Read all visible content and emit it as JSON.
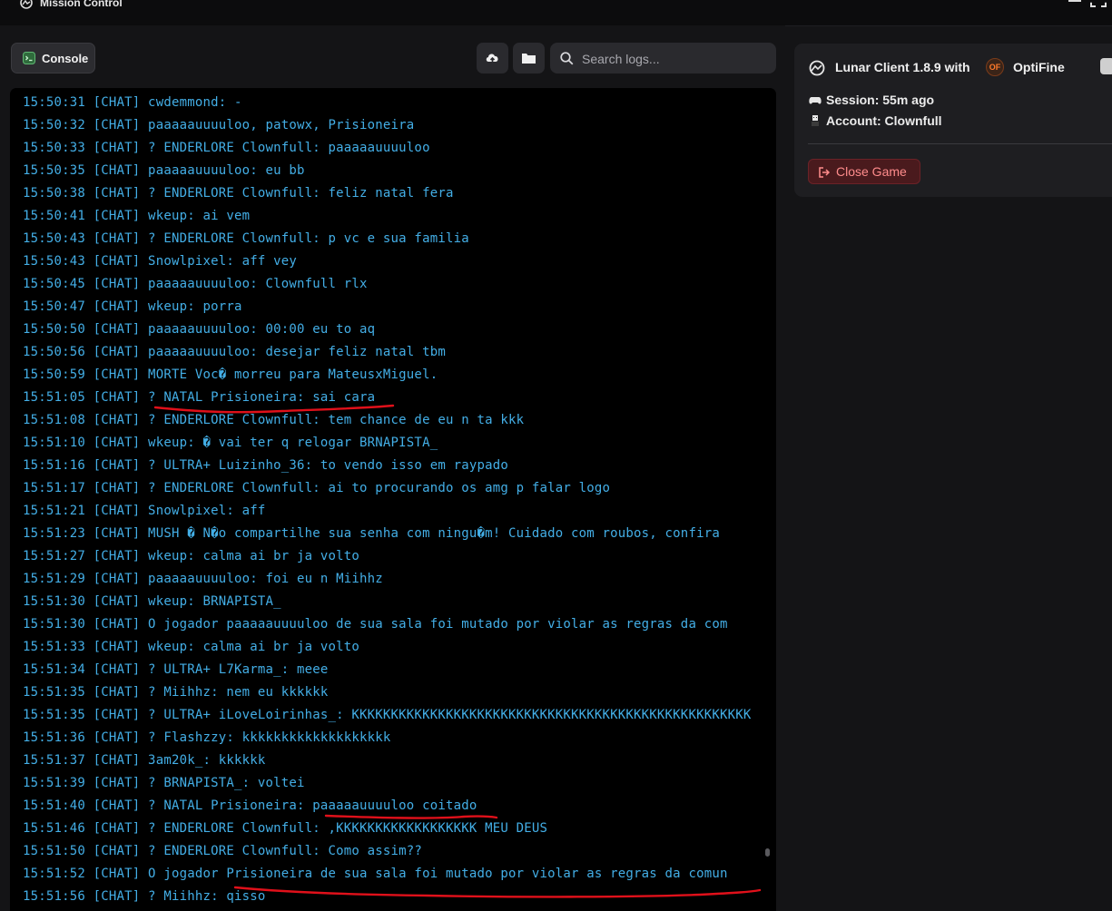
{
  "window": {
    "title": "Mission Control"
  },
  "toolbar": {
    "console_label": "Console",
    "search_placeholder": "Search logs..."
  },
  "log_lines": [
    "15:50:31 [CHAT] cwdemmond: -",
    "15:50:32 [CHAT] paaaaauuuuloo, patowx, Prisioneira",
    "15:50:33 [CHAT] ? ENDERLORE Clownfull: paaaaauuuuloo",
    "15:50:35 [CHAT] paaaaauuuuloo: eu bb",
    "15:50:38 [CHAT] ? ENDERLORE Clownfull: feliz natal fera",
    "15:50:41 [CHAT] wkeup: ai vem",
    "15:50:43 [CHAT] ? ENDERLORE Clownfull: p vc e sua familia",
    "15:50:43 [CHAT] Snowlpixel: aff vey",
    "15:50:45 [CHAT] paaaaauuuuloo: Clownfull rlx",
    "15:50:47 [CHAT] wkeup: porra",
    "15:50:50 [CHAT] paaaaauuuuloo: 00:00 eu to aq",
    "15:50:56 [CHAT] paaaaauuuuloo: desejar feliz natal tbm",
    "15:50:59 [CHAT] MORTE Voc� morreu para MateusxMiguel.",
    "15:51:05 [CHAT] ? NATAL Prisioneira: sai cara",
    "15:51:08 [CHAT] ? ENDERLORE Clownfull: tem chance de eu n ta kkk",
    "15:51:10 [CHAT] wkeup: � vai ter q relogar BRNAPISTA_",
    "15:51:16 [CHAT] ? ULTRA+ Luizinho_36: to vendo isso em raypado",
    "15:51:17 [CHAT] ? ENDERLORE Clownfull: ai to procurando os amg p falar logo",
    "15:51:21 [CHAT] Snowlpixel: aff",
    "15:51:23 [CHAT] MUSH � N�o compartilhe sua senha com ningu�m! Cuidado com roubos, confira",
    "15:51:27 [CHAT] wkeup: calma ai br ja volto",
    "15:51:29 [CHAT] paaaaauuuuloo: foi eu n Miihhz",
    "15:51:30 [CHAT] wkeup: BRNAPISTA_",
    "15:51:30 [CHAT] O jogador paaaaauuuuloo de sua sala foi mutado por violar as regras da com",
    "15:51:33 [CHAT] wkeup: calma ai br ja volto",
    "15:51:34 [CHAT] ? ULTRA+ L7Karma_: meee",
    "15:51:35 [CHAT] ? Miihhz: nem eu kkkkkk",
    "15:51:35 [CHAT] ? ULTRA+ iLoveLoirinhas_: KKKKKKKKKKKKKKKKKKKKKKKKKKKKKKKKKKKKKKKKKKKKKKKKKKK",
    "15:51:36 [CHAT] ? Flashzzy: kkkkkkkkkkkkkkkkkkk",
    "15:51:37 [CHAT] 3am20k_: kkkkkk",
    "15:51:39 [CHAT] ? BRNAPISTA_: voltei",
    "15:51:40 [CHAT] ? NATAL Prisioneira: paaaaauuuuloo coitado",
    "15:51:46 [CHAT] ? ENDERLORE Clownfull: ,KKKKKKKKKKKKKKKKKK MEU DEUS",
    "15:51:50 [CHAT] ? ENDERLORE Clownfull: Como assim??",
    "15:51:52 [CHAT] O jogador Prisioneira de sua sala foi mutado por violar as regras da comun",
    "15:51:56 [CHAT] ? Miihhz: qisso"
  ],
  "info": {
    "game_title": "Lunar Client 1.8.9 with",
    "optifine_badge": "OF",
    "optifine_label": "OptiFine",
    "session": "Session: 55m ago",
    "account": "Account: Clownfull",
    "close_label": "Close Game"
  },
  "colors": {
    "log_text": "#43aee6",
    "annotation": "#e0101a",
    "close_button_text": "#ff8c8c"
  }
}
